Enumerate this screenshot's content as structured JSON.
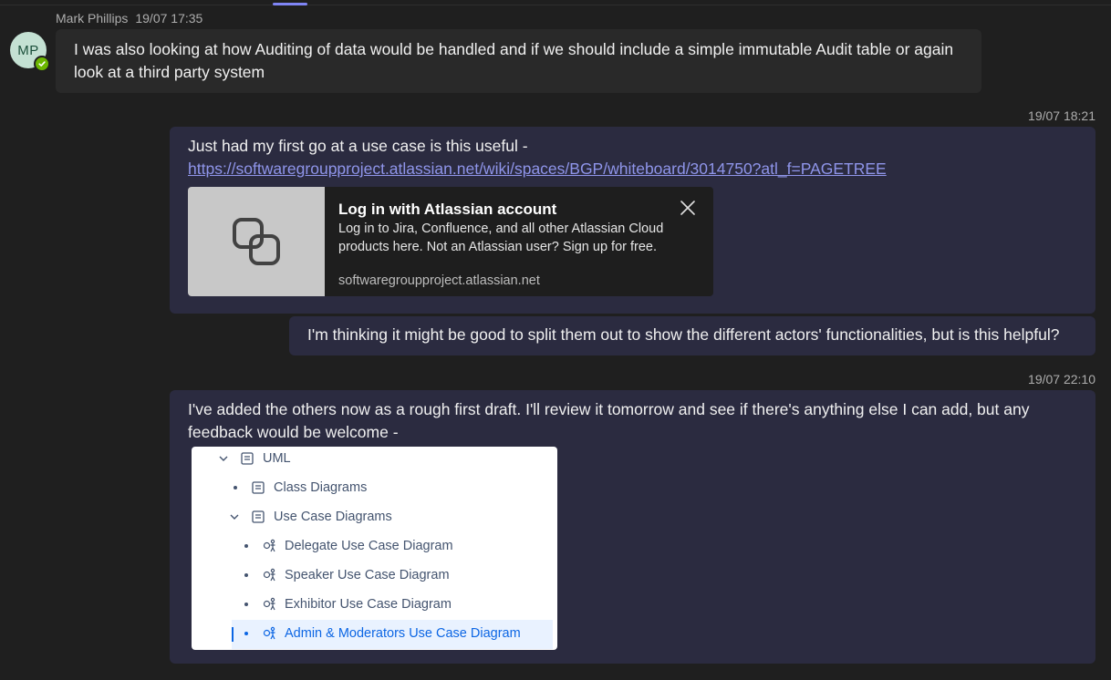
{
  "incoming": {
    "sender": "Mark Phillips",
    "time": "19/07 17:35",
    "initials": "MP",
    "text": "I was also looking at how Auditing of data would be handled and if we should include a simple immutable Audit table or again look at a third party system"
  },
  "outgoing": [
    {
      "timestamp": "19/07 18:21",
      "text": "Just had my first go at a use case is this useful -",
      "link": "https://softwaregroupproject.atlassian.net/wiki/spaces/BGP/whiteboard/3014750?atl_f=PAGETREE",
      "preview": {
        "title": "Log in with Atlassian account",
        "description": "Log in to Jira, Confluence, and all other Atlassian Cloud products here. Not an Atlassian user? Sign up for free.",
        "domain": "softwaregroupproject.atlassian.net",
        "icon": "link-icon"
      }
    },
    {
      "text": "I'm thinking it might be good to split them out to show the different actors' functionalities, but is this helpful?"
    },
    {
      "timestamp": "19/07 22:10",
      "text": "I've added the others now as a rough first draft. I'll review it tomorrow and see if there's anything else I can add, but any feedback would be welcome -",
      "tree": {
        "root": "UML",
        "class_diagrams": "Class Diagrams",
        "use_case_diagrams": "Use Case Diagrams",
        "items": [
          "Delegate Use Case Diagram",
          "Speaker Use Case Diagram",
          "Exhibitor Use Case Diagram",
          "Admin & Moderators Use Case Diagram"
        ]
      }
    }
  ],
  "colors": {
    "background": "#1f1f1f",
    "incoming_bubble": "#292929",
    "outgoing_bubble": "#2b2b40",
    "link": "#8f95ea",
    "presence": "#6bb700"
  }
}
